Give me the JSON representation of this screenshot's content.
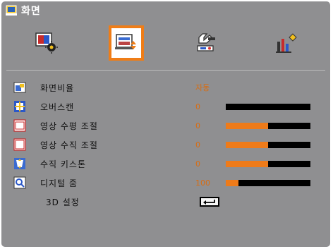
{
  "window": {
    "title": "화면"
  },
  "tabs": [
    {
      "icon": "picture-settings-icon",
      "active": false
    },
    {
      "icon": "display-settings-icon",
      "active": true
    },
    {
      "icon": "setup-icon",
      "active": false
    },
    {
      "icon": "options-icon",
      "active": false
    }
  ],
  "items": [
    {
      "label": "화면비율",
      "value": "자동",
      "icon": "aspect-ratio-icon"
    },
    {
      "label": "오버스캔",
      "value": "0",
      "icon": "overscan-icon",
      "level": 0
    },
    {
      "label": "영상 수평 조절",
      "value": "0",
      "icon": "h-image-shift-icon",
      "level": 0.5
    },
    {
      "label": "영상 수직 조절",
      "value": "0",
      "icon": "v-image-shift-icon",
      "level": 0.5
    },
    {
      "label": "수직 키스톤",
      "value": "0",
      "icon": "keystone-icon",
      "level": 0.5
    },
    {
      "label": "디지털 줌",
      "value": "100",
      "icon": "digital-zoom-icon",
      "level": 0.15
    },
    {
      "label": "3D 설정",
      "icon": "enter-key-icon"
    }
  ],
  "colors": {
    "background": "#8f8f91",
    "accent": "#ef7d17",
    "value_text": "#d96c10",
    "bar_track": "#000000"
  }
}
